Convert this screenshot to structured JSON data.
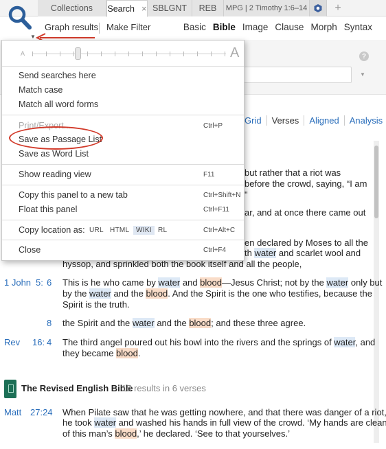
{
  "tabs": [
    {
      "label": "Collections"
    },
    {
      "label": "Search",
      "close": "×"
    },
    {
      "label": "SBLGNT"
    },
    {
      "label": "REB"
    },
    {
      "label": "MPG | 2 Timothy 1:6–14"
    }
  ],
  "new_tab": "+",
  "toolbar": {
    "graph_results": "Graph results",
    "make_filter": "Make Filter",
    "modes": [
      "Basic",
      "Bible",
      "Image",
      "Clause",
      "Morph",
      "Syntax"
    ],
    "selected_mode": "Bible",
    "help": "?"
  },
  "view_tabs": [
    "Grid",
    "Verses",
    "Aligned",
    "Analysis"
  ],
  "menu": {
    "small_a": "A",
    "large_a": "A",
    "items": {
      "send_searches": "Send searches here",
      "match_case": "Match case",
      "match_all": "Match all word forms",
      "print_export": "Print/Export...",
      "print_shortcut": "Ctrl+P",
      "save_passage": "Save as Passage List",
      "save_word": "Save as Word List",
      "show_reading": "Show reading view",
      "show_reading_shortcut": "F11",
      "copy_panel": "Copy this panel to a new tab",
      "copy_panel_shortcut": "Ctrl+Shift+N",
      "float_panel": "Float this panel",
      "float_panel_shortcut": "Ctrl+F11",
      "copy_location": "Copy location as:",
      "copy_location_shortcut": "Ctrl+Alt+C",
      "copy_options": [
        "URL",
        "HTML",
        "WIKI",
        "RL"
      ],
      "selected_copy_option": "WIKI",
      "close": "Close",
      "close_shortcut": "Ctrl+F4"
    }
  },
  "results": {
    "partial_lines": {
      "l1": "but rather that a riot was",
      "l2": "before the crowd, saying, “I am",
      "l3": "\"",
      "l4": "ar, and at once there came out",
      "l5": "en declared by Moses to all the",
      "l6a": "th ",
      "l6b": "water",
      "l6c": " and scarlet wool and",
      "l7": "hyssop, and sprinkled both the book itself and all the people,"
    },
    "john": {
      "ref_book": "1 John",
      "ref_chap": "5:",
      "ref_verse": "6",
      "v8_ref": "8"
    },
    "rev": {
      "ref_book": "Rev",
      "ref_chap": "16:",
      "ref_verse": "4"
    }
  },
  "reb": {
    "title": "The Revised English Bible",
    "count": "15 results in 6 verses",
    "matt_book": "Matt",
    "matt_ref": "27:24"
  }
}
